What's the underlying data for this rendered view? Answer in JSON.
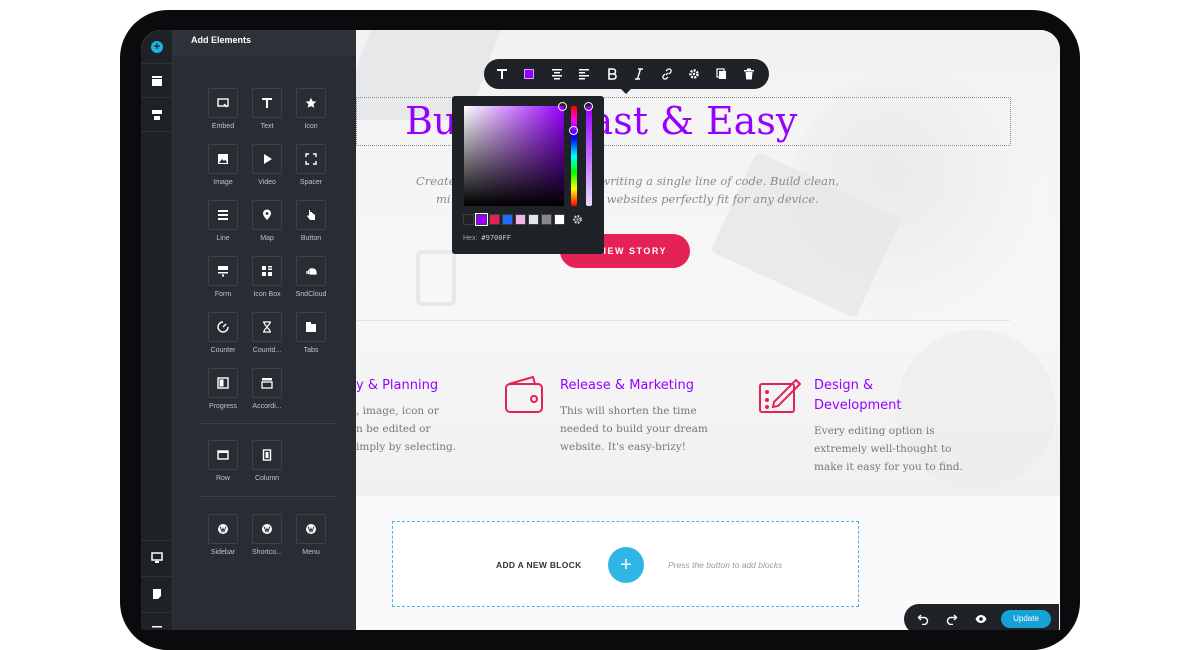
{
  "panel": {
    "title": "Add Elements",
    "elements": [
      {
        "label": "Embed",
        "icon": "embed-icon"
      },
      {
        "label": "Text",
        "icon": "text-icon"
      },
      {
        "label": "Icon",
        "icon": "star-icon"
      },
      {
        "label": "Image",
        "icon": "image-icon"
      },
      {
        "label": "Video",
        "icon": "play-icon"
      },
      {
        "label": "Spacer",
        "icon": "spacer-icon"
      },
      {
        "label": "Line",
        "icon": "line-icon"
      },
      {
        "label": "Map",
        "icon": "map-pin-icon"
      },
      {
        "label": "Button",
        "icon": "pointer-icon"
      },
      {
        "label": "Form",
        "icon": "form-icon"
      },
      {
        "label": "Icon Box",
        "icon": "icon-box-icon"
      },
      {
        "label": "SndCloud",
        "icon": "soundcloud-icon"
      },
      {
        "label": "Counter",
        "icon": "counter-icon"
      },
      {
        "label": "Countd...",
        "icon": "hourglass-icon"
      },
      {
        "label": "Tabs",
        "icon": "tabs-icon"
      },
      {
        "label": "Progress",
        "icon": "progress-icon"
      },
      {
        "label": "Accordi...",
        "icon": "accordion-icon"
      },
      {
        "label": "Row",
        "icon": "row-icon"
      },
      {
        "label": "Column",
        "icon": "column-icon"
      },
      {
        "label": "Sidebar",
        "icon": "wordpress-icon"
      },
      {
        "label": "Shortco...",
        "icon": "wordpress-icon"
      },
      {
        "label": "Menu",
        "icon": "wordpress-icon"
      }
    ]
  },
  "hero": {
    "headline_part1": "Bu",
    "headline_part2": "tes Fast & Easy",
    "subtext_line1_a": "Create",
    "subtext_line1_b": "writing a single line of code. Build clean,",
    "subtext_line2_a": "mi",
    "subtext_line2_b": "d websites perfectly fit for any device.",
    "cta_label": "VIEW STORY"
  },
  "features": [
    {
      "title": "y & Planning",
      "lines": [
        ", image, icon or",
        "n be edited or",
        "imply by selecting."
      ],
      "icon": "planning-icon"
    },
    {
      "title": "Release & Marketing",
      "lines": [
        "This will shorten the time",
        "needed to build your dream",
        "website. It's easy-brizy!"
      ],
      "icon": "wallet-icon"
    },
    {
      "title_lines": [
        "Design &",
        "Development"
      ],
      "lines": [
        "Every editing option is",
        "extremely well-thought to",
        "make it easy for you to find."
      ],
      "icon": "design-icon"
    }
  ],
  "add_block": {
    "label": "ADD A NEW BLOCK",
    "hint": "Press the button to add blocks"
  },
  "color_picker": {
    "hex_label": "Hex:",
    "hex_value": "#9700FF",
    "swatches": [
      "#1f2226",
      "#9700ff",
      "#e52155",
      "#1f6bff",
      "#f3b6e4",
      "#e5e5e5",
      "#888888",
      "#ffffff"
    ]
  },
  "bottom_bar": {
    "update_label": "Update"
  },
  "colors": {
    "accent": "#9700ff",
    "brand_red": "#e52155",
    "primary_blue": "#30b6e5"
  }
}
